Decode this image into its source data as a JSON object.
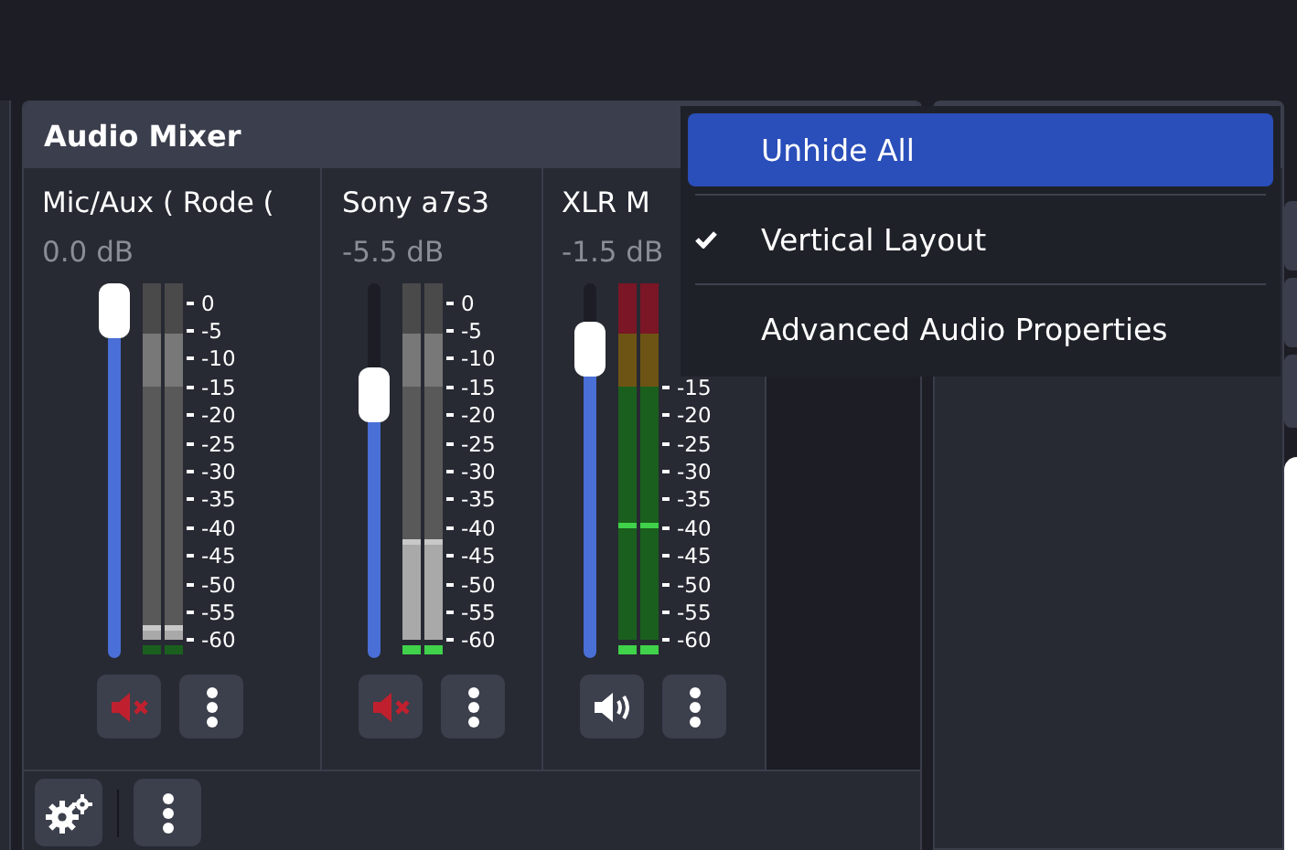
{
  "panel": {
    "title": "Audio Mixer"
  },
  "channels": [
    {
      "name": "Mic/Aux ( Rode (",
      "volume": "0.0 dB",
      "muted": true,
      "fader": {
        "level": 1
      },
      "meter": {
        "level": 0.04,
        "scale": [
          "0",
          "-5",
          "-10",
          "-15",
          "-20",
          "-25",
          "-30",
          "-35",
          "-40",
          "-45",
          "-50",
          "-55",
          "-60"
        ]
      }
    },
    {
      "name": "Sony a7s3",
      "volume": "-5.5 dB",
      "muted": true,
      "fader": {
        "level": 0.74
      },
      "meter": {
        "level": 0.28,
        "scale": [
          "0",
          "-5",
          "-10",
          "-15",
          "-20",
          "-25",
          "-30",
          "-35",
          "-40",
          "-45",
          "-50",
          "-55",
          "-60"
        ]
      }
    },
    {
      "name": "XLR M",
      "volume": "-1.5 dB",
      "muted": false,
      "fader": {
        "level": 0.88
      },
      "meter": {
        "level": 0.33,
        "scale": [
          "-15",
          "-20",
          "-25",
          "-30",
          "-35",
          "-40",
          "-45",
          "-50",
          "-55",
          "-60"
        ]
      }
    }
  ],
  "menu": {
    "items": [
      {
        "label": "Unhide All",
        "selected": true,
        "checked": false
      },
      {
        "label": "Vertical Layout",
        "selected": false,
        "checked": true
      },
      {
        "label": "Advanced Audio Properties",
        "selected": false,
        "checked": false
      }
    ]
  }
}
